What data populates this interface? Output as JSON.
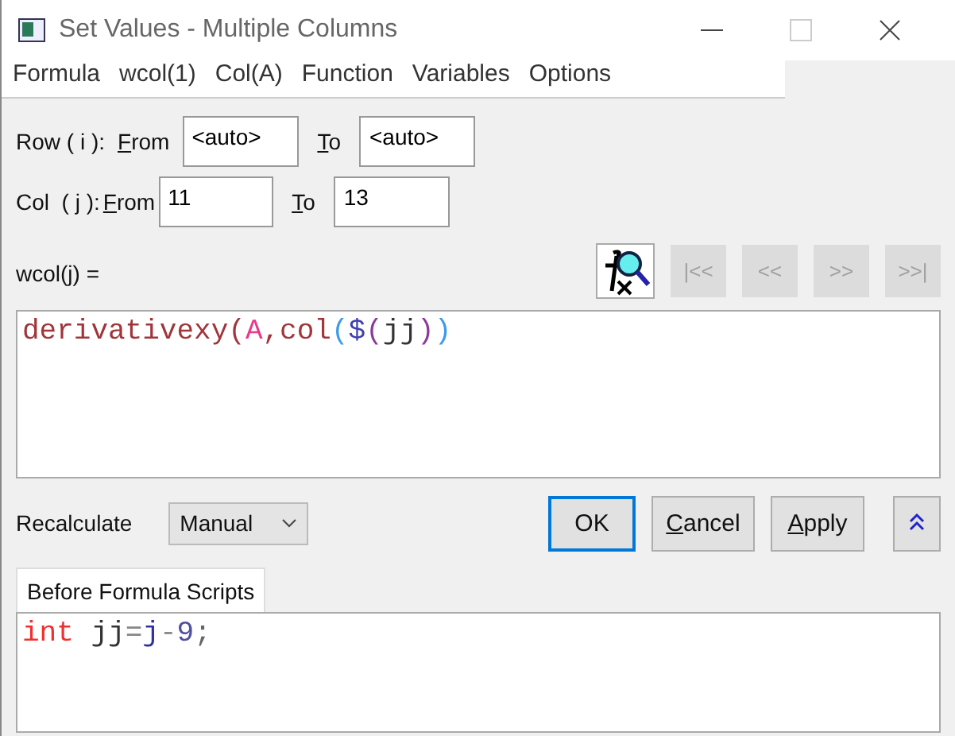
{
  "window": {
    "title": "Set Values - Multiple Columns"
  },
  "menu": [
    "Formula",
    "wcol(1)",
    "Col(A)",
    "Function",
    "Variables",
    "Options"
  ],
  "ranges": [
    {
      "label": "Row ( i ):",
      "from_label": "From",
      "from_value": "<auto>",
      "to_label": "To",
      "to_value": "<auto>"
    },
    {
      "label": "Col  ( j ):",
      "from_label": "From",
      "from_value": "11",
      "to_label": "To",
      "to_value": "13"
    }
  ],
  "formula_label": "wcol(j) =",
  "nav_buttons": [
    {
      "label": "|<<",
      "disabled": true
    },
    {
      "label": "<<",
      "disabled": true
    },
    {
      "label": ">>",
      "disabled": true
    },
    {
      "label": ">>|",
      "disabled": true
    }
  ],
  "formula": [
    {
      "text": "derivativexy",
      "color": "#a0353a"
    },
    {
      "text": "(",
      "color": "#a0353a"
    },
    {
      "text": "A",
      "color": "#e8388a"
    },
    {
      "text": ",col",
      "color": "#a0353a"
    },
    {
      "text": "(",
      "color": "#3d9be9"
    },
    {
      "text": "$",
      "color": "#4040b0"
    },
    {
      "text": "(",
      "color": "#8a3a9a"
    },
    {
      "text": "jj",
      "color": "#333333"
    },
    {
      "text": ")",
      "color": "#8a3a9a"
    },
    {
      "text": ")",
      "color": "#3d9be9"
    }
  ],
  "recalculate": {
    "label": "Recalculate",
    "value": "Manual"
  },
  "buttons": [
    {
      "label": "OK",
      "default": true,
      "underlined_first": false
    },
    {
      "label": "Cancel",
      "default": false,
      "underlined_first": true
    },
    {
      "label": "Apply",
      "default": false,
      "underlined_first": true
    }
  ],
  "tab": {
    "label": "Before Formula Scripts",
    "selected": true
  },
  "script": [
    {
      "text": "int",
      "color": "#f03030"
    },
    {
      "text": " jj",
      "color": "#333333"
    },
    {
      "text": "=",
      "color": "#888888"
    },
    {
      "text": "j",
      "color": "#3030a0"
    },
    {
      "text": "-",
      "color": "#888888"
    },
    {
      "text": "9",
      "color": "#5050a0"
    },
    {
      "text": ";",
      "color": "#666666"
    }
  ]
}
